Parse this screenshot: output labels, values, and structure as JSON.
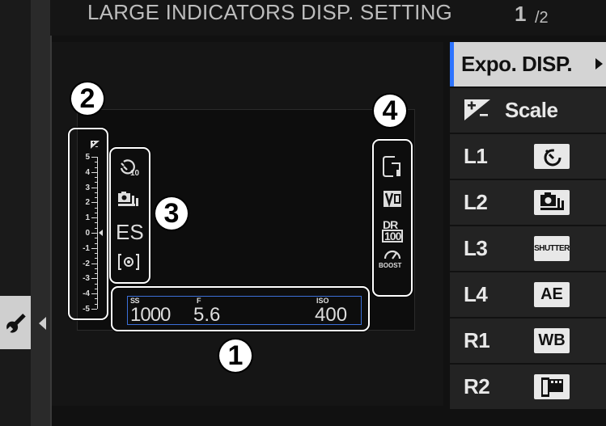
{
  "header": {
    "title": "LARGE INDICATORS DISP. SETTING",
    "page_current": "1",
    "page_total": "/2"
  },
  "callouts": [
    "1",
    "2",
    "3",
    "4"
  ],
  "scale": {
    "top_label": "+/-",
    "labels": [
      "5",
      "4",
      "3",
      "2",
      "1",
      "0",
      "-1",
      "-2",
      "-3",
      "-4",
      "-5"
    ]
  },
  "group3": {
    "drive_mode": "ES",
    "timer_sub": "10"
  },
  "group4": {
    "dr_top": "DR",
    "dr_bottom": "100",
    "boost": "BOOST"
  },
  "exposure": {
    "ss_label": "SS",
    "ss_value": "1000",
    "f_label": "F",
    "f_value": "5.6",
    "iso_label": "ISO",
    "iso_value": "400"
  },
  "menu": {
    "items": [
      {
        "label": "Expo. DISP.",
        "selected": true,
        "icon": "chevron-right-icon"
      },
      {
        "label": "Scale",
        "icon": "exposure-compensation-icon"
      },
      {
        "label": "L1",
        "icon": "self-timer-icon"
      },
      {
        "label": "L2",
        "icon": "continuous-shooting-icon"
      },
      {
        "label": "L3",
        "icon_text": "SHUTTER"
      },
      {
        "label": "L4",
        "icon_text": "AE"
      },
      {
        "label": "R1",
        "icon_text": "WB"
      },
      {
        "label": "R2",
        "icon": "film-simulation-icon"
      }
    ]
  },
  "colors": {
    "accent": "#2d73ff",
    "selected_bg": "#d4d4d4",
    "item_bg": "#232323",
    "text": "#e8e8e8"
  }
}
